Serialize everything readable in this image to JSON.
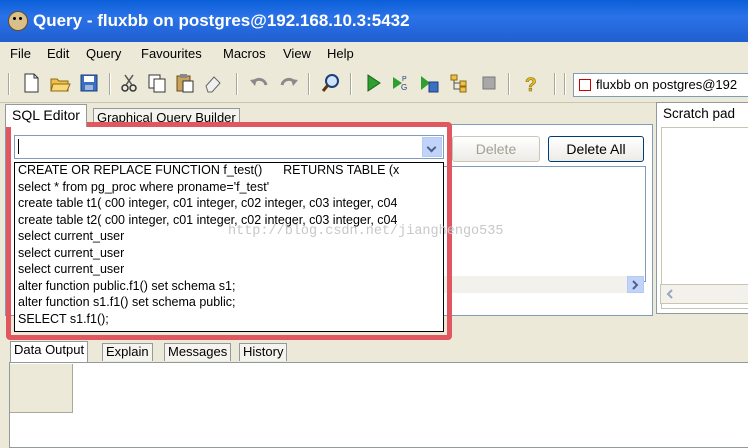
{
  "window": {
    "title": "Query - fluxbb on postgres@192.168.10.3:5432"
  },
  "menu": {
    "items": [
      "File",
      "Edit",
      "Query",
      "Favourites",
      "Macros",
      "View",
      "Help"
    ]
  },
  "toolbar": {
    "connection": "fluxbb on postgres@192",
    "icons": [
      "new-file-icon",
      "open-folder-icon",
      "save-icon",
      "cut-icon",
      "copy-icon",
      "paste-icon",
      "eraser-icon",
      "undo-icon",
      "redo-icon",
      "find-icon",
      "execute-icon",
      "execute-pgscript-icon",
      "execute-to-file-icon",
      "explain-icon",
      "cancel-icon",
      "help-icon"
    ]
  },
  "editor_tabs": [
    "SQL Editor",
    "Graphical Query Builder"
  ],
  "history": {
    "current_value": "",
    "items": [
      "CREATE OR REPLACE FUNCTION f_test()      RETURNS TABLE (x",
      "select * from pg_proc where proname='f_test'",
      "create table t1( c00 integer, c01 integer, c02 integer, c03 integer, c04",
      "create table t2( c00 integer, c01 integer, c02 integer, c03 integer, c04",
      "select current_user",
      "select current_user",
      "select current_user",
      "alter function public.f1() set schema s1;",
      "alter function s1.f1() set schema public;",
      "SELECT s1.f1();"
    ]
  },
  "buttons": {
    "delete": "Delete",
    "delete_all": "Delete All"
  },
  "scratch_pad": {
    "title": "Scratch pad"
  },
  "output_tabs": [
    "Data Output",
    "Explain",
    "Messages",
    "History"
  ],
  "watermark": "http://blog.csdn.net/jianghengo535"
}
